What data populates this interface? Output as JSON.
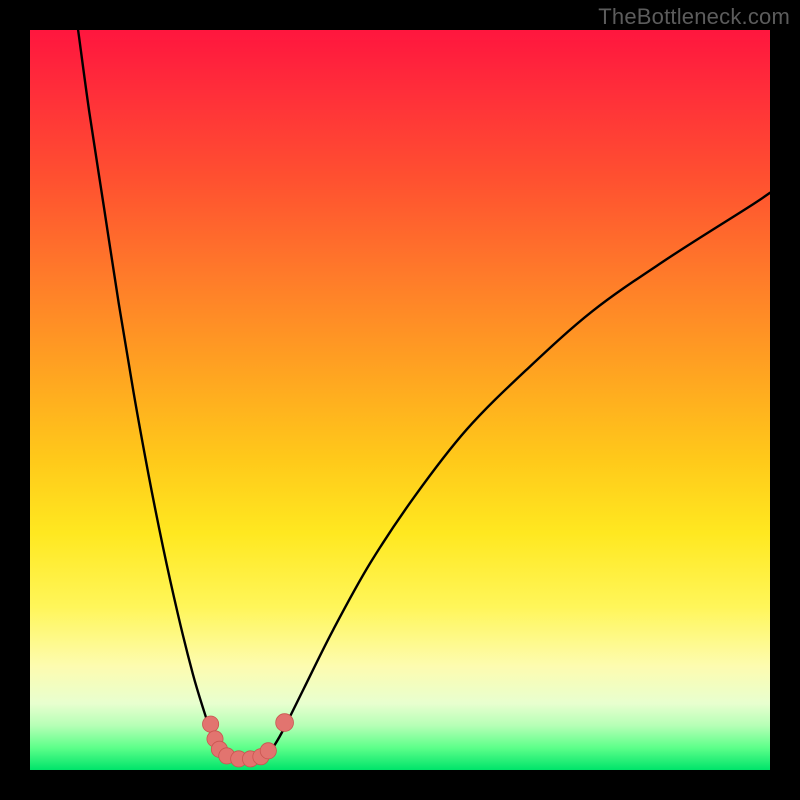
{
  "watermark": "TheBottleneck.com",
  "colors": {
    "frame": "#000000",
    "curve_stroke": "#000000",
    "marker_fill": "#e2746f",
    "marker_stroke": "#c95550"
  },
  "chart_data": {
    "type": "line",
    "title": "",
    "xlabel": "",
    "ylabel": "",
    "xlim": [
      0,
      100
    ],
    "ylim": [
      0,
      100
    ],
    "grid": false,
    "legend": false,
    "series": [
      {
        "name": "left-branch",
        "x": [
          6.5,
          8,
          10,
          12,
          14,
          16,
          18,
          20,
          22,
          23.5,
          24.5,
          25.2,
          25.6
        ],
        "y": [
          100,
          89,
          76,
          63,
          51,
          40,
          30,
          21,
          13,
          8,
          5,
          3,
          2.2
        ]
      },
      {
        "name": "valley-floor",
        "x": [
          25.6,
          27,
          29,
          31,
          32.3
        ],
        "y": [
          2.2,
          1.6,
          1.4,
          1.6,
          2.2
        ]
      },
      {
        "name": "right-branch",
        "x": [
          32.3,
          34,
          37,
          41,
          46,
          52,
          59,
          67,
          76,
          86,
          97,
          100
        ],
        "y": [
          2.2,
          5,
          11,
          19,
          28,
          37,
          46,
          54,
          62,
          69,
          76,
          78
        ]
      }
    ],
    "markers": [
      {
        "x": 24.4,
        "y": 6.2,
        "r": 1.1
      },
      {
        "x": 25.0,
        "y": 4.2,
        "r": 1.1
      },
      {
        "x": 25.6,
        "y": 2.8,
        "r": 1.1
      },
      {
        "x": 26.6,
        "y": 1.9,
        "r": 1.1
      },
      {
        "x": 28.2,
        "y": 1.5,
        "r": 1.1
      },
      {
        "x": 29.8,
        "y": 1.5,
        "r": 1.1
      },
      {
        "x": 31.2,
        "y": 1.8,
        "r": 1.1
      },
      {
        "x": 32.2,
        "y": 2.6,
        "r": 1.1
      },
      {
        "x": 34.4,
        "y": 6.4,
        "r": 1.2
      }
    ],
    "gradient_stops": [
      {
        "pos": 0.0,
        "color": "#ff163e"
      },
      {
        "pos": 0.2,
        "color": "#ff5030"
      },
      {
        "pos": 0.46,
        "color": "#ffa321"
      },
      {
        "pos": 0.68,
        "color": "#ffe820"
      },
      {
        "pos": 0.86,
        "color": "#fdfcb0"
      },
      {
        "pos": 0.94,
        "color": "#b6ffb6"
      },
      {
        "pos": 1.0,
        "color": "#00e46a"
      }
    ]
  }
}
